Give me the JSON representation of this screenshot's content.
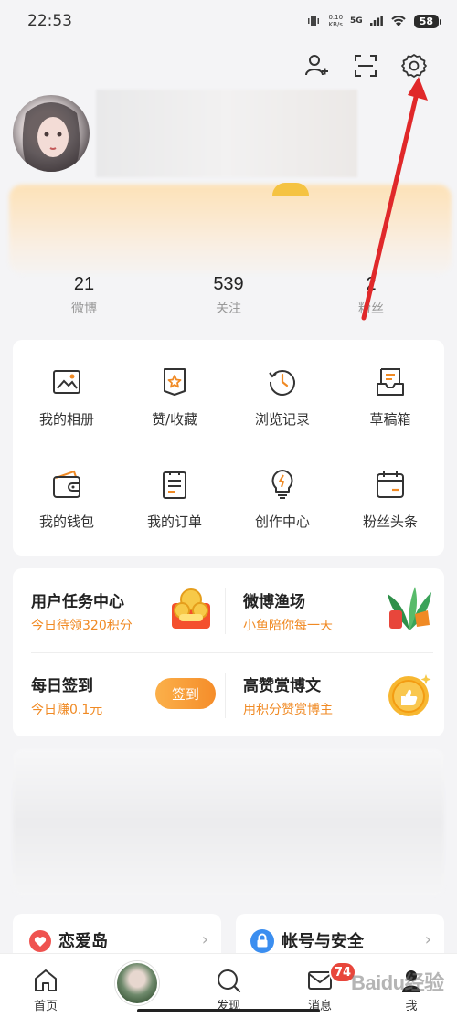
{
  "status_bar": {
    "time": "22:53",
    "net_speed": "0.10",
    "net_unit": "KB/s",
    "network": "5G",
    "battery": "58"
  },
  "header_icons": {
    "add_friend": "add-user-icon",
    "scan": "scan-icon",
    "settings": "gear-icon"
  },
  "stats": [
    {
      "value": "21",
      "label": "微博"
    },
    {
      "value": "539",
      "label": "关注"
    },
    {
      "value": "2",
      "label": "粉丝"
    }
  ],
  "grid": [
    {
      "label": "我的相册",
      "icon": "photo-album-icon"
    },
    {
      "label": "赞/收藏",
      "icon": "favorite-icon"
    },
    {
      "label": "浏览记录",
      "icon": "history-icon"
    },
    {
      "label": "草稿箱",
      "icon": "drafts-icon"
    },
    {
      "label": "我的钱包",
      "icon": "wallet-icon"
    },
    {
      "label": "我的订单",
      "icon": "orders-icon"
    },
    {
      "label": "创作中心",
      "icon": "creator-center-icon"
    },
    {
      "label": "粉丝头条",
      "icon": "fans-headline-icon"
    }
  ],
  "tasks": {
    "task_center": {
      "title": "用户任务中心",
      "subtitle": "今日待领320积分"
    },
    "fishing": {
      "title": "微博渔场",
      "subtitle": "小鱼陪你每一天"
    },
    "checkin": {
      "title": "每日签到",
      "subtitle": "今日赚0.1元",
      "button": "签到"
    },
    "reward": {
      "title": "高赞赏博文",
      "subtitle": "用积分赞赏博主"
    }
  },
  "bottom_cards": [
    {
      "label": "恋爱岛",
      "icon": "heart-icon"
    },
    {
      "label": "帐号与安全",
      "icon": "lock-icon"
    }
  ],
  "nav": [
    {
      "label": "首页",
      "icon": "home-icon"
    },
    {
      "label": "",
      "icon": "avatar"
    },
    {
      "label": "发现",
      "icon": "search-icon"
    },
    {
      "label": "消息",
      "icon": "mail-icon",
      "badge": "74"
    },
    {
      "label": "我",
      "icon": "profile-icon"
    }
  ],
  "watermark": "Baidu经验",
  "colors": {
    "accent_orange": "#f08a24",
    "arrow_red": "#e0282a",
    "badge_red": "#e8463b"
  }
}
